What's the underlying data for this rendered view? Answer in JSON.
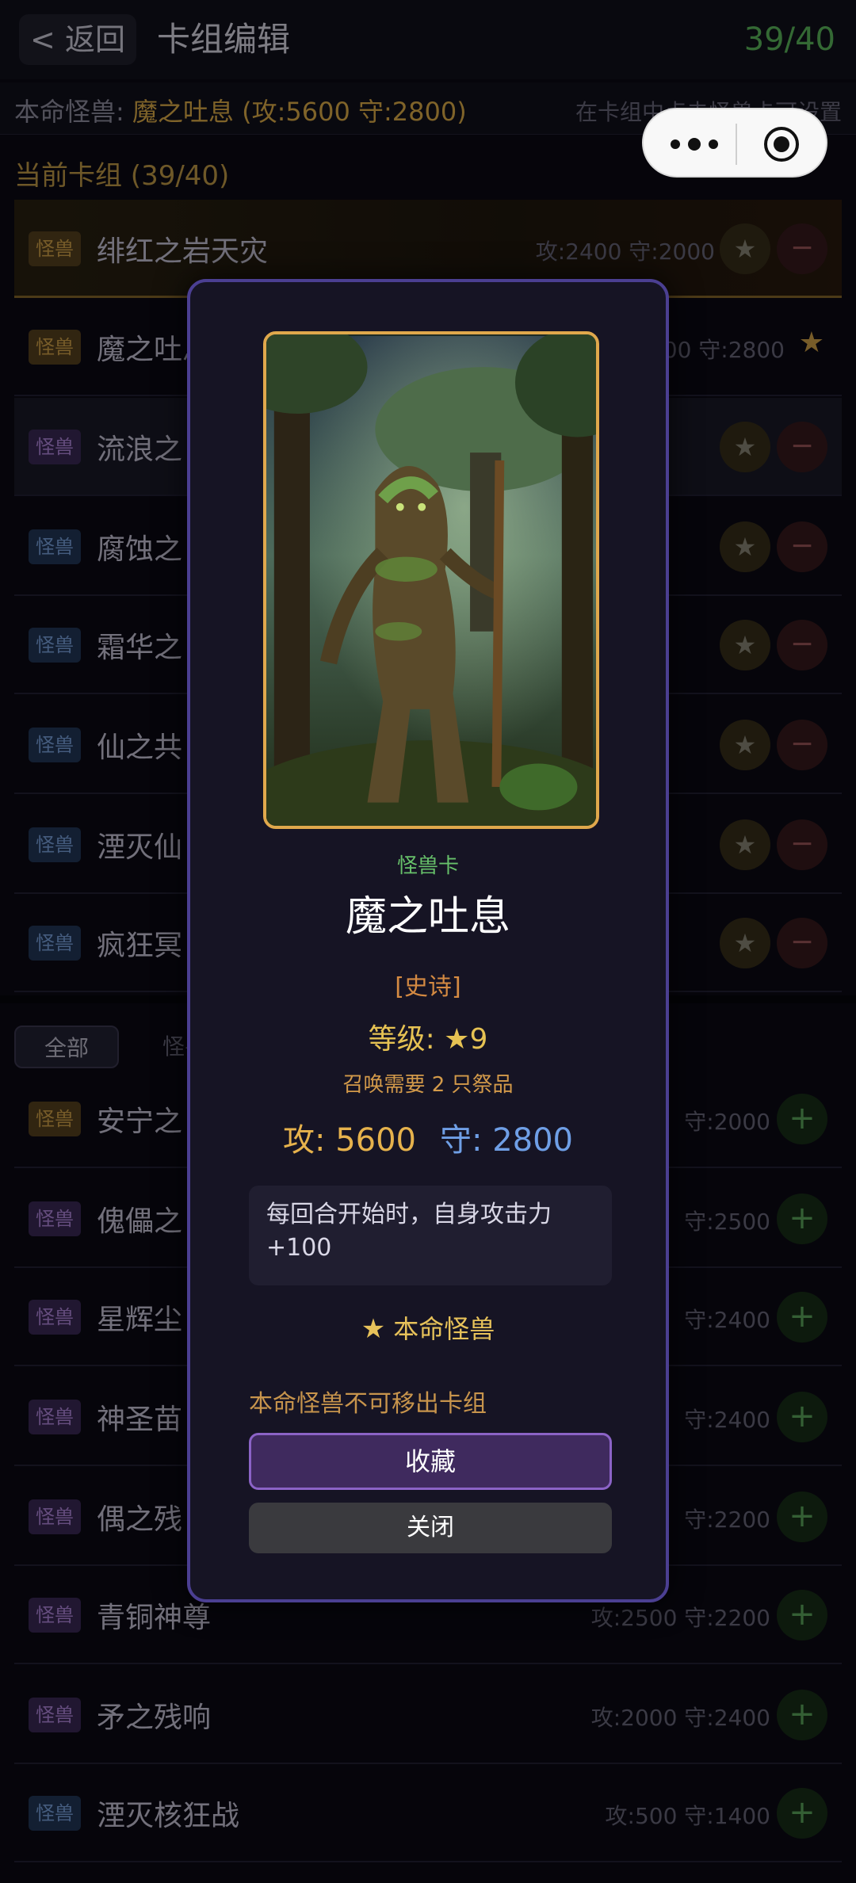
{
  "header": {
    "back_label": "< 返回",
    "title": "卡组编辑",
    "deck_count": "39/40"
  },
  "main_beast": {
    "label": "本命怪兽: ",
    "value": "魔之吐息 (攻:5600 守:2800)",
    "hint": "在卡组中点击怪兽卡可设置"
  },
  "deck_section": {
    "title": "当前卡组 (39/40)"
  },
  "deck_cards": [
    {
      "tag": "怪兽",
      "name": "绯红之岩天灾",
      "stats": "攻:2400 守:2000",
      "color": "gold"
    },
    {
      "tag": "怪兽",
      "name": "魔之吐息",
      "stats": "攻:5600 守:2800",
      "color": "gold"
    },
    {
      "tag": "怪兽",
      "name": "流浪之",
      "stats": "",
      "color": "purple"
    },
    {
      "tag": "怪兽",
      "name": "腐蚀之",
      "stats": "",
      "color": "blue"
    },
    {
      "tag": "怪兽",
      "name": "霜华之",
      "stats": "",
      "color": "blue"
    },
    {
      "tag": "怪兽",
      "name": "仙之共",
      "stats": "",
      "color": "blue"
    },
    {
      "tag": "怪兽",
      "name": "湮灭仙",
      "stats": "",
      "color": "blue"
    },
    {
      "tag": "怪兽",
      "name": "疯狂冥",
      "stats": "",
      "color": "blue"
    }
  ],
  "filter_tabs": [
    "全部",
    "怪兽"
  ],
  "pool_cards": [
    {
      "tag": "怪兽",
      "name": "安宁之",
      "stats": "守:2000",
      "color": "gold"
    },
    {
      "tag": "怪兽",
      "name": "傀儡之",
      "stats": "守:2500",
      "color": "purple"
    },
    {
      "tag": "怪兽",
      "name": "星辉尘",
      "stats": "守:2400",
      "color": "purple"
    },
    {
      "tag": "怪兽",
      "name": "神圣苗",
      "stats": "守:2400",
      "color": "purple"
    },
    {
      "tag": "怪兽",
      "name": "偶之残",
      "stats": "守:2200",
      "color": "purple"
    },
    {
      "tag": "怪兽",
      "name": "青铜神尊",
      "stats": "攻:2500 守:2200",
      "color": "purple"
    },
    {
      "tag": "怪兽",
      "name": "矛之残响",
      "stats": "攻:2000 守:2400",
      "color": "purple"
    },
    {
      "tag": "怪兽",
      "name": "湮灭核狂战",
      "stats": "攻:500 守:1400",
      "color": "blue"
    }
  ],
  "modal": {
    "kind": "怪兽卡",
    "name": "魔之吐息",
    "rarity": "[史诗]",
    "level": "等级: ★9",
    "summon": "召唤需要 2 只祭品",
    "atk": "攻: 5600",
    "def": "守: 2800",
    "effect": "每回合开始时，自身攻击力+100",
    "badge_star": "★",
    "badge": "本命怪兽",
    "warning": "本命怪兽不可移出卡组",
    "collect_label": "收藏",
    "close_label": "关闭"
  },
  "icons": {
    "star": "★",
    "minus": "−",
    "plus": "+"
  },
  "colors": {
    "accent_gold": "#e6b24c",
    "accent_blue": "#6f9fe6",
    "modal_border": "#4b3f92",
    "collect_btn": "#3f2a5e"
  }
}
